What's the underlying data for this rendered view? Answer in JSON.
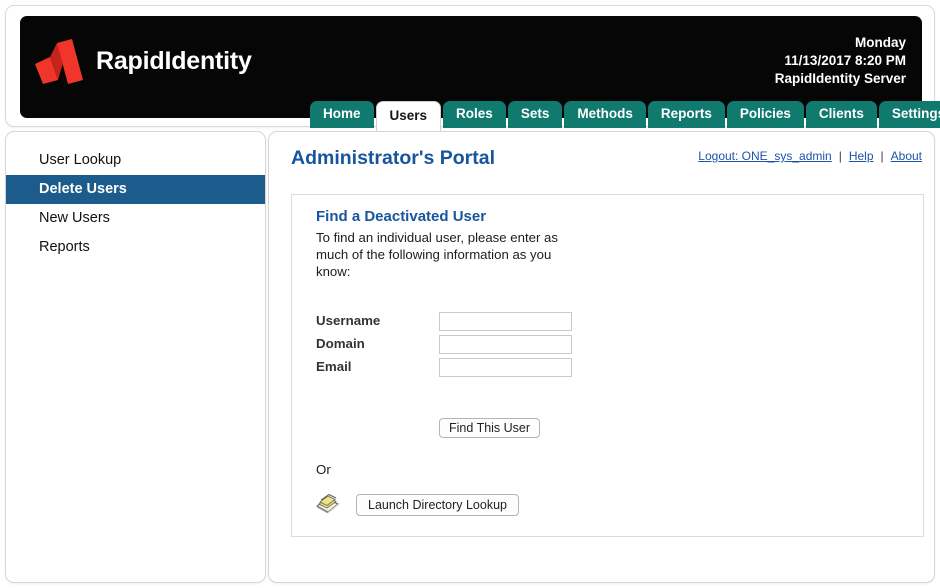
{
  "header": {
    "brand_name": "RapidIdentity",
    "logo_icon": "rapididentity-logo-icon",
    "logo_color": "#ee3124",
    "meta": {
      "day": "Monday",
      "datetime": "11/13/2017 8:20 PM",
      "server": "RapidIdentity Server"
    }
  },
  "tabs": [
    {
      "label": "Home",
      "active": false
    },
    {
      "label": "Users",
      "active": true
    },
    {
      "label": "Roles",
      "active": false
    },
    {
      "label": "Sets",
      "active": false
    },
    {
      "label": "Methods",
      "active": false
    },
    {
      "label": "Reports",
      "active": false
    },
    {
      "label": "Policies",
      "active": false
    },
    {
      "label": "Clients",
      "active": false
    },
    {
      "label": "Settings",
      "active": false
    }
  ],
  "sidebar": {
    "items": [
      {
        "label": "User Lookup",
        "active": false
      },
      {
        "label": "Delete Users",
        "active": true
      },
      {
        "label": "New Users",
        "active": false
      },
      {
        "label": "Reports",
        "active": false
      }
    ]
  },
  "main": {
    "page_title": "Administrator's Portal",
    "top_links": {
      "logout": "Logout: ONE_sys_admin",
      "separator": "|",
      "help": "Help",
      "about": "About"
    },
    "card": {
      "title": "Find a Deactivated User",
      "description": "To find an individual user, please enter as much of the following information as you know:",
      "fields": [
        {
          "label": "Username",
          "value": "",
          "placeholder": ""
        },
        {
          "label": "Domain",
          "value": "",
          "placeholder": ""
        },
        {
          "label": "Email",
          "value": "",
          "placeholder": ""
        }
      ],
      "find_button": "Find This User",
      "or_text": "Or",
      "directory_icon": "directory-book-icon",
      "launch_button": "Launch Directory Lookup"
    }
  },
  "colors": {
    "tab_teal": "#117a6f",
    "sidebar_active_blue": "#1b5c8c",
    "title_blue": "#17559c",
    "link_blue": "#1b55a8",
    "header_black": "#060606",
    "logo_red": "#ee3124"
  }
}
